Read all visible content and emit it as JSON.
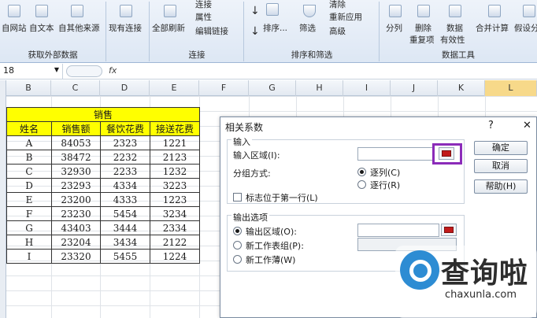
{
  "ribbon": {
    "buttons": [
      "自网站",
      "自文本",
      "自其他来源",
      "现有连接",
      "全部刷新",
      "连接",
      "属性",
      "编辑链接",
      "排序...",
      "筛选",
      "清除",
      "重新应用",
      "高级",
      "分列",
      "删除",
      "重复项",
      "数据",
      "有效性",
      "合并计算",
      "假设分"
    ],
    "groups": [
      "获取外部数据",
      "连接",
      "排序和筛选",
      "数据工具"
    ]
  },
  "formula_bar": {
    "name_box": "18",
    "fx": "fx"
  },
  "columns": [
    "B",
    "C",
    "D",
    "E",
    "F",
    "G",
    "H",
    "I",
    "J",
    "K",
    "L"
  ],
  "table": {
    "title": "销售",
    "headers": [
      "姓名",
      "销售额",
      "餐饮花费",
      "接送花费"
    ],
    "rows": [
      [
        "A",
        "84053",
        "2323",
        "1221"
      ],
      [
        "B",
        "38472",
        "2232",
        "2123"
      ],
      [
        "C",
        "32930",
        "2233",
        "1232"
      ],
      [
        "D",
        "23293",
        "4334",
        "3223"
      ],
      [
        "E",
        "23200",
        "4333",
        "1223"
      ],
      [
        "F",
        "23230",
        "5454",
        "3234"
      ],
      [
        "G",
        "43403",
        "3444",
        "2334"
      ],
      [
        "H",
        "23204",
        "3434",
        "2122"
      ],
      [
        "I",
        "23320",
        "5455",
        "1224"
      ]
    ]
  },
  "dialog": {
    "title": "相关系数",
    "help_glyph": "?",
    "close_glyph": "✕",
    "input_section": "输入",
    "input_range_label": "输入区域(I):",
    "group_by_label": "分组方式:",
    "by_column": "逐列(C)",
    "by_row": "逐行(R)",
    "labels_first_row": "标志位于第一行(L)",
    "output_section": "输出选项",
    "output_range": "输出区域(O):",
    "new_sheet": "新工作表组(P):",
    "new_workbook": "新工作薄(W)",
    "ok": "确定",
    "cancel": "取消",
    "help": "帮助(H)",
    "highlight_color": "#8b2bb9"
  },
  "watermark": {
    "main": "查询啦",
    "sub": "chaxunla.com"
  }
}
